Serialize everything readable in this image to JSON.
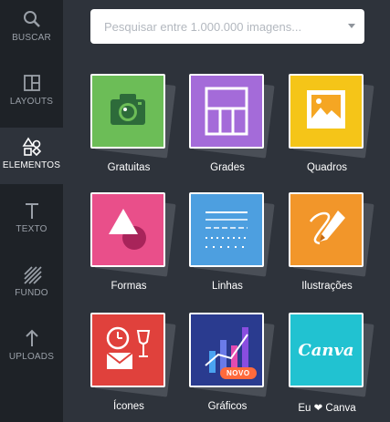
{
  "sidebar": {
    "items": [
      {
        "label": "BUSCAR",
        "icon": "search-icon"
      },
      {
        "label": "LAYOUTS",
        "icon": "layouts-icon"
      },
      {
        "label": "ELEMENTOS",
        "icon": "elements-icon"
      },
      {
        "label": "TEXTO",
        "icon": "text-icon"
      },
      {
        "label": "FUNDO",
        "icon": "background-pattern-icon"
      },
      {
        "label": "UPLOADS",
        "icon": "upload-arrow-icon"
      }
    ],
    "active": "ELEMENTOS"
  },
  "search": {
    "placeholder": "Pesquisar entre 1.000.000 imagens..."
  },
  "tiles": [
    {
      "label": "Gratuitas",
      "color": "#6cbd57",
      "icon": "camera-icon"
    },
    {
      "label": "Grades",
      "color": "#a46bd9",
      "icon": "grid-icon"
    },
    {
      "label": "Quadros",
      "color": "#f5c518",
      "icon": "photo-frame-icon"
    },
    {
      "label": "Formas",
      "color": "#e94f8a",
      "icon": "shapes-icon"
    },
    {
      "label": "Linhas",
      "color": "#4d9fe0",
      "icon": "lines-icon"
    },
    {
      "label": "Ilustrações",
      "color": "#f2962a",
      "icon": "pencil-icon"
    },
    {
      "label": "Ícones",
      "color": "#e0413c",
      "icon": "clock-envelope-icon"
    },
    {
      "label": "Gráficos",
      "color": "#2a3b8f",
      "icon": "bar-chart-icon",
      "badge": "NOVO"
    },
    {
      "label": "Eu ❤ Canva",
      "color": "#21c2d1",
      "icon": "canva-logo-icon",
      "logo_text": "Canva"
    }
  ]
}
